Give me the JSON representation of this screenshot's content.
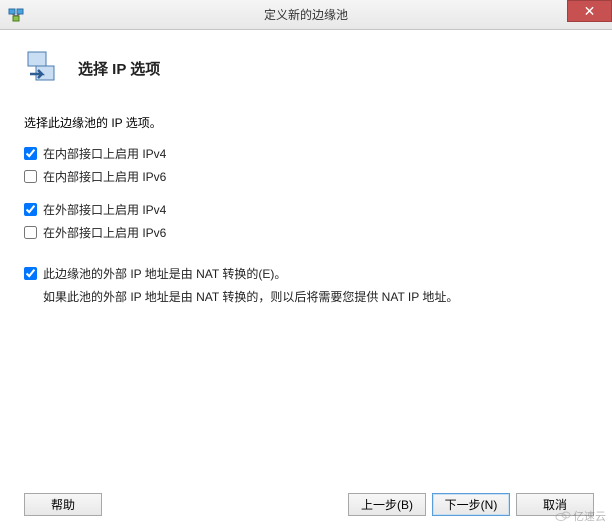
{
  "window": {
    "title": "定义新的边缘池"
  },
  "header": {
    "title": "选择 IP 选项"
  },
  "instruction": "选择此边缘池的 IP 选项。",
  "options": {
    "internal_ipv4": {
      "label": "在内部接口上启用 IPv4",
      "checked": true
    },
    "internal_ipv6": {
      "label": "在内部接口上启用 IPv6",
      "checked": false
    },
    "external_ipv4": {
      "label": "在外部接口上启用 IPv4",
      "checked": true
    },
    "external_ipv6": {
      "label": "在外部接口上启用 IPv6",
      "checked": false
    },
    "nat": {
      "label": "此边缘池的外部 IP 地址是由 NAT 转换的(E)。",
      "note": "如果此池的外部 IP 地址是由 NAT 转换的，则以后将需要您提供 NAT IP 地址。",
      "checked": true
    }
  },
  "buttons": {
    "help": "帮助",
    "back": "上一步(B)",
    "next": "下一步(N)",
    "cancel": "取消"
  },
  "watermark": "亿速云"
}
